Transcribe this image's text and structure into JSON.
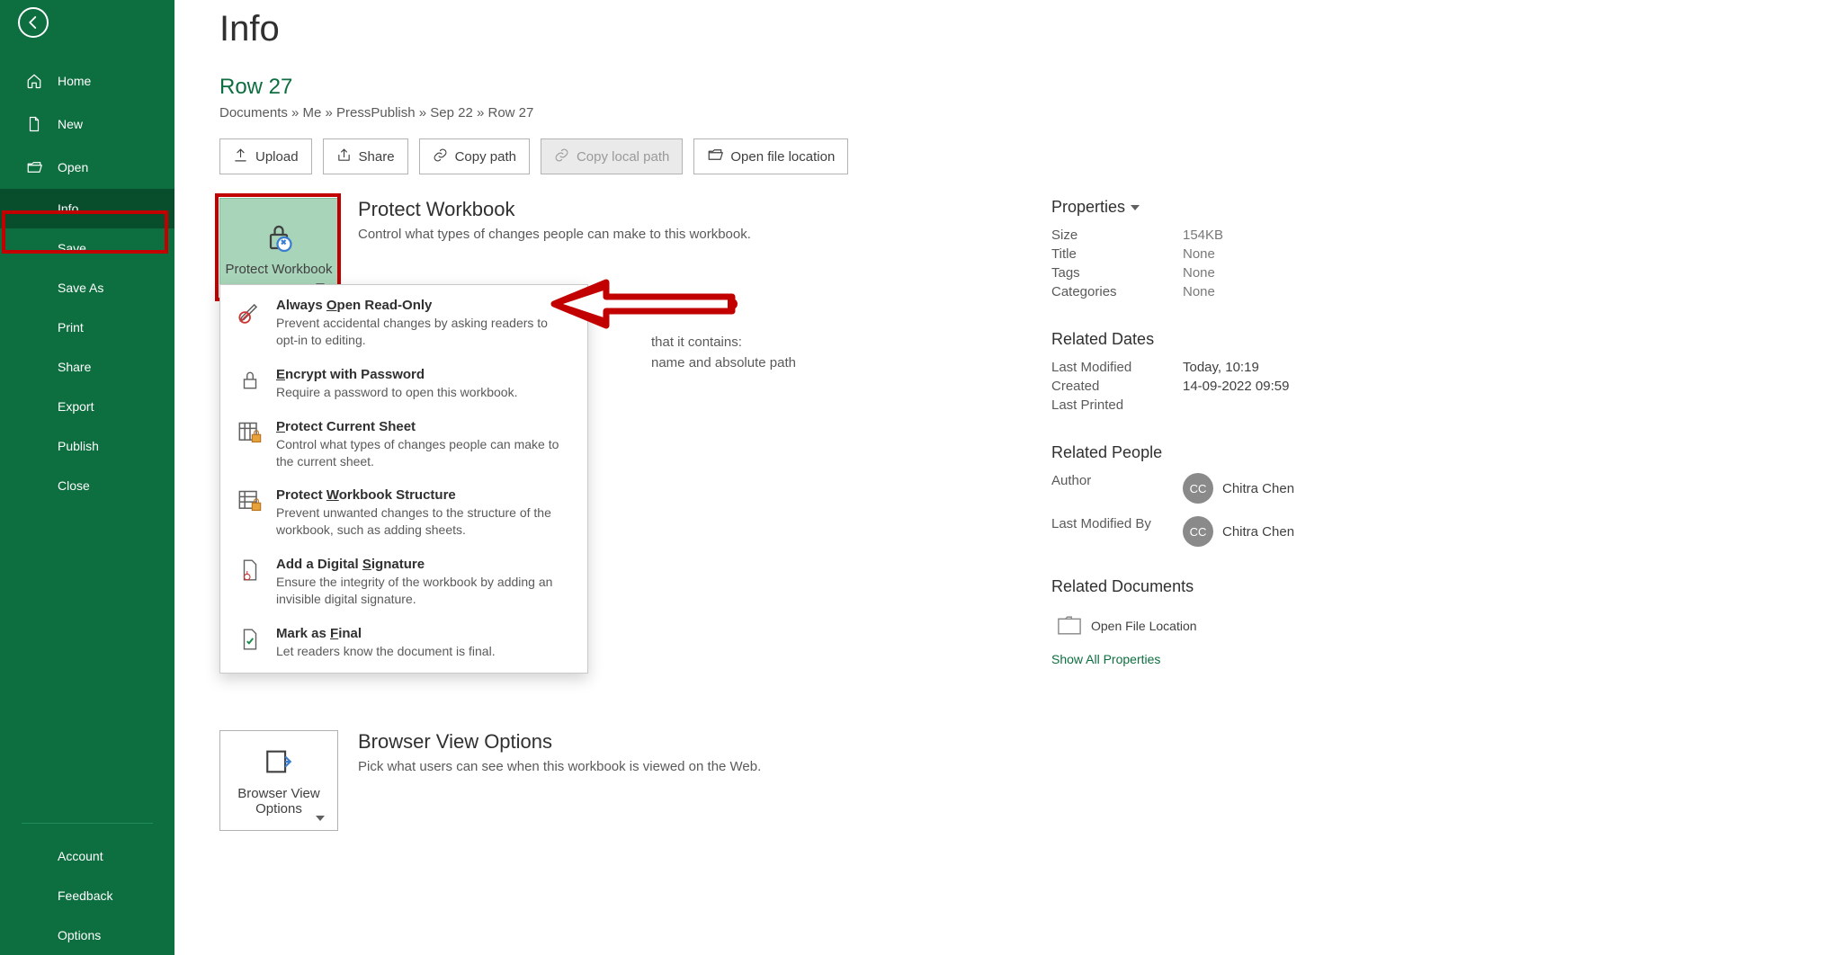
{
  "sidebar": {
    "items": [
      {
        "id": "home",
        "label": "Home",
        "icon": "home-icon"
      },
      {
        "id": "new",
        "label": "New",
        "icon": "file-icon"
      },
      {
        "id": "open",
        "label": "Open",
        "icon": "folder-open-icon"
      },
      {
        "id": "info",
        "label": "Info",
        "active": true,
        "indent": true
      },
      {
        "id": "save",
        "label": "Save",
        "indent": true
      },
      {
        "id": "saveas",
        "label": "Save As",
        "indent": true
      },
      {
        "id": "print",
        "label": "Print",
        "indent": true
      },
      {
        "id": "share",
        "label": "Share",
        "indent": true
      },
      {
        "id": "export",
        "label": "Export",
        "indent": true
      },
      {
        "id": "publish",
        "label": "Publish",
        "indent": true
      },
      {
        "id": "close",
        "label": "Close",
        "indent": true
      }
    ],
    "footer": [
      {
        "id": "account",
        "label": "Account"
      },
      {
        "id": "feedback",
        "label": "Feedback"
      },
      {
        "id": "options",
        "label": "Options"
      }
    ]
  },
  "page": {
    "title": "Info",
    "docName": "Row 27",
    "breadcrumb": "Documents » Me » PressPublish » Sep 22 » Row 27"
  },
  "actions": [
    {
      "id": "upload",
      "label": "Upload",
      "icon": "upload-icon"
    },
    {
      "id": "share",
      "label": "Share",
      "icon": "share-icon"
    },
    {
      "id": "copypath",
      "label": "Copy path",
      "icon": "link-icon"
    },
    {
      "id": "copylocal",
      "label": "Copy local path",
      "icon": "link-icon",
      "disabled": true
    },
    {
      "id": "openloc",
      "label": "Open file location",
      "icon": "folder-open-icon"
    }
  ],
  "protect": {
    "buttonLabel": "Protect Workbook",
    "title": "Protect Workbook",
    "desc": "Control what types of changes people can make to this workbook."
  },
  "dropdown": [
    {
      "title": "Always Open Read-Only",
      "desc": "Prevent accidental changes by asking readers to opt-in to editing.",
      "icon": "pencil-no-icon",
      "accent": "O"
    },
    {
      "title": "Encrypt with Password",
      "desc": "Require a password to open this workbook.",
      "icon": "lock-icon",
      "accent": "E"
    },
    {
      "title": "Protect Current Sheet",
      "desc": "Control what types of changes people can make to the current sheet.",
      "icon": "sheet-lock-icon",
      "accent": "P"
    },
    {
      "title": "Protect Workbook Structure",
      "desc": "Prevent unwanted changes to the structure of the workbook, such as adding sheets.",
      "icon": "workbook-lock-icon",
      "accent": "W"
    },
    {
      "title": "Add a Digital Signature",
      "desc": "Ensure the integrity of the workbook by adding an invisible digital signature.",
      "icon": "signature-icon",
      "accent": "S"
    },
    {
      "title": "Mark as Final",
      "desc": "Let readers know the document is final.",
      "icon": "final-icon",
      "accent": "F"
    }
  ],
  "inspect": {
    "line1": "that it contains:",
    "line2": "name and absolute path"
  },
  "browser": {
    "buttonLabel": "Browser View Options",
    "title": "Browser View Options",
    "desc": "Pick what users can see when this workbook is viewed on the Web."
  },
  "properties": {
    "heading": "Properties",
    "rows": [
      {
        "lbl": "Size",
        "val": "154KB"
      },
      {
        "lbl": "Title",
        "val": "None"
      },
      {
        "lbl": "Tags",
        "val": "None"
      },
      {
        "lbl": "Categories",
        "val": "None"
      }
    ],
    "datesHeading": "Related Dates",
    "dateRows": [
      {
        "lbl": "Last Modified",
        "val": "Today, 10:19"
      },
      {
        "lbl": "Created",
        "val": "14-09-2022 09:59"
      },
      {
        "lbl": "Last Printed",
        "val": ""
      }
    ],
    "peopleHeading": "Related People",
    "author": {
      "lbl": "Author",
      "initials": "CC",
      "name": "Chitra Chen"
    },
    "modifiedBy": {
      "lbl": "Last Modified By",
      "initials": "CC",
      "name": "Chitra Chen"
    },
    "docsHeading": "Related Documents",
    "openFileLoc": "Open File Location",
    "showAll": "Show All Properties"
  }
}
